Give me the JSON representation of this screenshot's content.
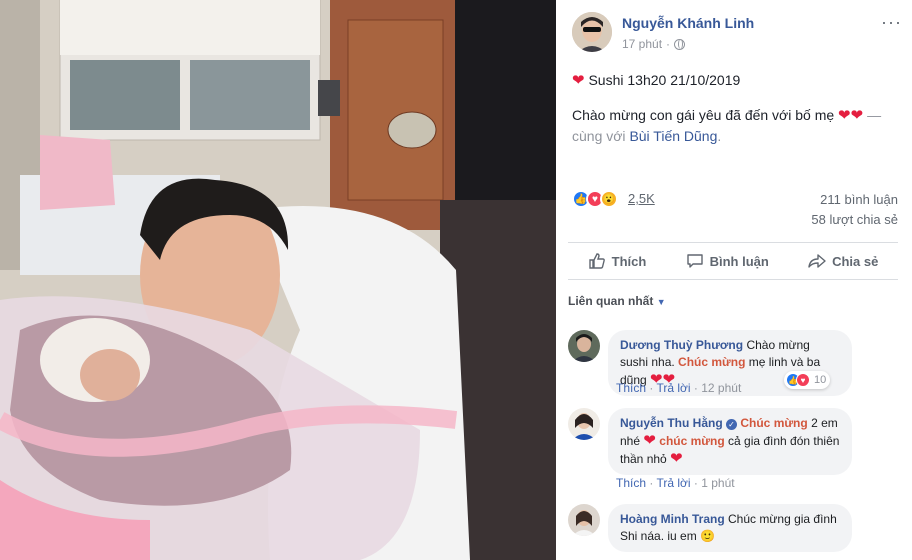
{
  "post": {
    "author": "Nguyễn Khánh Linh",
    "time": "17 phút",
    "more_icon": "···",
    "line1_text": "Sushi 13h20 21/10/2019",
    "line2_text": "Chào mừng con gái yêu đã đến với bố mẹ",
    "with_prefix": "— cùng với",
    "with_person": "Bùi Tiến Dũng",
    "with_suffix": "."
  },
  "stats": {
    "reactions": "2,5K",
    "comments": "211 bình luận",
    "shares": "58 lượt chia sẻ"
  },
  "actions": {
    "like": "Thích",
    "comment": "Bình luận",
    "share": "Chia sẻ"
  },
  "sort_label": "Liên quan nhất",
  "comments": [
    {
      "name": "Dương Thuỳ Phương",
      "text_a": "Chào mừng sushi nha.",
      "tag": "Chúc mừng",
      "text_b": "mẹ linh và ba dũng",
      "like": "Thích",
      "reply": "Trả lời",
      "time": "12 phút",
      "reaction_count": "10"
    },
    {
      "name": "Nguyễn Thu Hằng",
      "tag": "Chúc mừng",
      "text_a": "2 em nhé",
      "tag2": "chúc mừng",
      "text_b": "cả gia đình đón thiên thần nhỏ",
      "like": "Thích",
      "reply": "Trả lời",
      "time": "1 phút"
    },
    {
      "name": "Hoàng Minh Trang",
      "text_a": "Chúc mừng gia đình Shi náa. iu em"
    }
  ],
  "colors": {
    "link": "#385898",
    "tag": "#d2573d",
    "heart": "#e41e3f",
    "like_blue": "#2078f4"
  }
}
